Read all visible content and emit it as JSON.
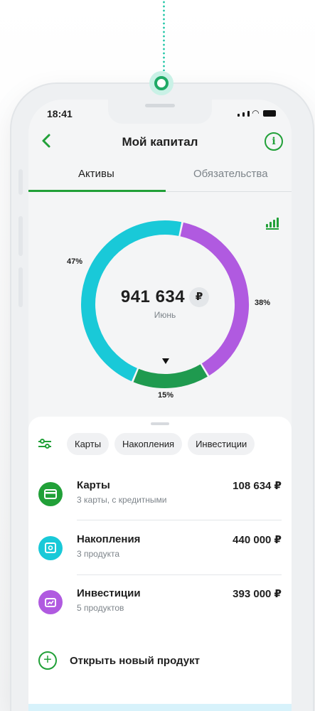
{
  "status_bar": {
    "time": "18:41"
  },
  "header": {
    "title": "Мой капитал"
  },
  "tabs": [
    {
      "label": "Активы"
    },
    {
      "label": "Обязательства"
    }
  ],
  "donut": {
    "segments": [
      {
        "name": "Карты",
        "percent_label": "47%",
        "share": 0.47,
        "color": "#19c9d8"
      },
      {
        "name": "Накопления",
        "percent_label": "38%",
        "share": 0.38,
        "color": "#b05ae0"
      },
      {
        "name": "Инвестиции",
        "percent_label": "15%",
        "share": 0.15,
        "color": "#1f9a4f"
      }
    ],
    "total_amount": "941 634",
    "currency": "₽",
    "period": "Июнь"
  },
  "filters": [
    {
      "label": "Карты"
    },
    {
      "label": "Накопления"
    },
    {
      "label": "Инвестиции"
    }
  ],
  "products": [
    {
      "name": "Карты",
      "subtitle": "3 карты, с кредитными",
      "amount": "108 634 ₽",
      "icon": "card-icon",
      "color": "#21a038"
    },
    {
      "name": "Накопления",
      "subtitle": "3 продукта",
      "amount": "440 000 ₽",
      "icon": "safe-icon",
      "color": "#19c9d8"
    },
    {
      "name": "Инвестиции",
      "subtitle": "5 продуктов",
      "amount": "393 000 ₽",
      "icon": "chart-case-icon",
      "color": "#b05ae0"
    }
  ],
  "open_product": {
    "label": "Открыть новый продукт"
  },
  "colors": {
    "accent": "#21a038",
    "cyan": "#19c9d8",
    "purple": "#b05ae0"
  }
}
